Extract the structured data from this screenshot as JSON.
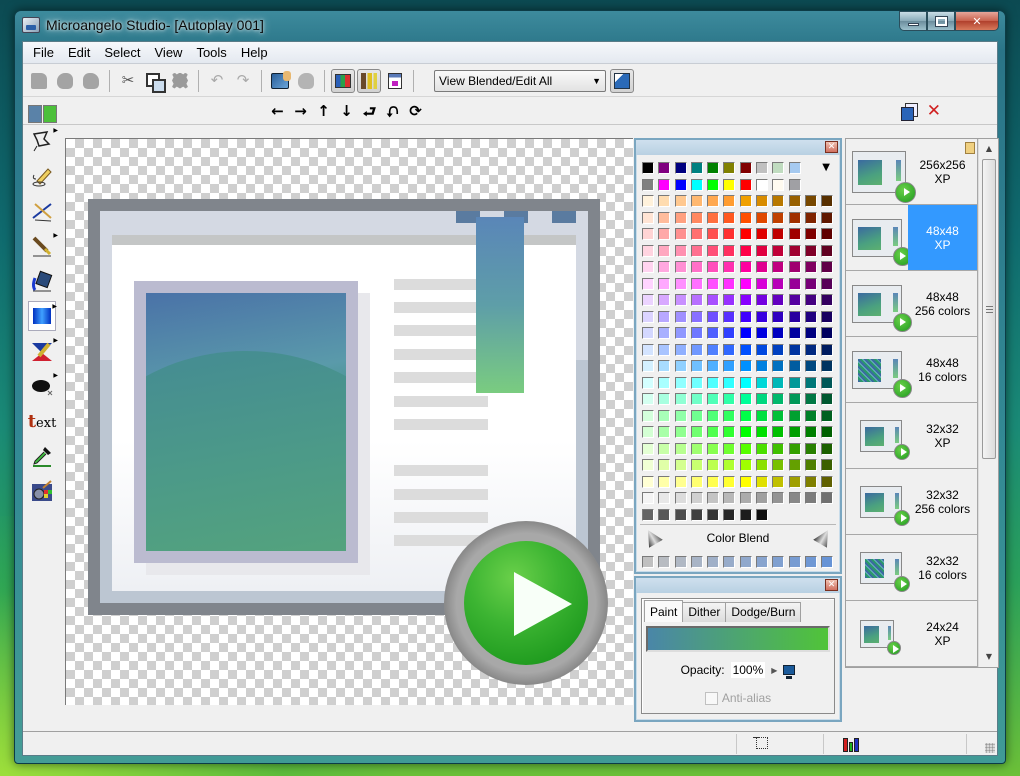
{
  "window": {
    "title": "Microangelo Studio- [Autoplay 001]",
    "caption_buttons": [
      "minimize",
      "maximize",
      "close"
    ]
  },
  "menu": [
    "File",
    "Edit",
    "Select",
    "View",
    "Tools",
    "Help"
  ],
  "toolbar": {
    "buttons": [
      {
        "name": "new-icon",
        "enabled": false
      },
      {
        "name": "open-icon",
        "enabled": false
      },
      {
        "name": "save-icon",
        "enabled": false
      },
      {
        "name": "cut-icon",
        "enabled": false
      },
      {
        "name": "copy-icon",
        "enabled": true
      },
      {
        "name": "paste-icon",
        "enabled": false
      },
      {
        "name": "undo-icon",
        "enabled": false
      },
      {
        "name": "redo-icon",
        "enabled": false
      },
      {
        "name": "import-icon",
        "enabled": true
      },
      {
        "name": "export-icon",
        "enabled": false
      },
      {
        "name": "palette-toggle-icon",
        "pressed": true
      },
      {
        "name": "tools-toggle-icon",
        "pressed": true
      },
      {
        "name": "window-icon",
        "pressed": false
      }
    ],
    "view_select": {
      "value": "View Blended/Edit All"
    },
    "preview_button": "preview-icon"
  },
  "toolbar2": {
    "primary_color": "#5a82a8",
    "secondary_color": "#4cc03a",
    "transforms": [
      "←",
      "→",
      "↑",
      "↓",
      "⮐",
      "⮏",
      "⟳"
    ],
    "transform_names": [
      "shift-left",
      "shift-right",
      "shift-up",
      "shift-down",
      "flip-horizontal",
      "flip-vertical",
      "rotate"
    ],
    "right_tools": [
      "duplicate-format-icon",
      "delete-format-icon"
    ]
  },
  "toolbox": [
    {
      "name": "lasso-select-tool",
      "submenu": true
    },
    {
      "name": "freehand-pencil-tool",
      "submenu": false
    },
    {
      "name": "line-tool",
      "submenu": false
    },
    {
      "name": "brush-tool",
      "submenu": true
    },
    {
      "name": "fill-bucket-tool",
      "submenu": false
    },
    {
      "name": "gradient-fill-tool",
      "submenu": true,
      "active": true
    },
    {
      "name": "color-replace-tool",
      "submenu": true
    },
    {
      "name": "ellipse-tool",
      "submenu": true
    },
    {
      "name": "text-tool",
      "submenu": false
    },
    {
      "name": "eyedropper-tool",
      "submenu": false
    },
    {
      "name": "effects-tool",
      "submenu": false
    }
  ],
  "palette": {
    "base_rows": [
      [
        "#000000",
        "#800080",
        "#000080",
        "#008080",
        "#008000",
        "#808000",
        "#800000",
        "#c0c0c0",
        "#c0dcc0",
        "#a6caf0"
      ],
      [
        "#808080",
        "#ff00ff",
        "#0000ff",
        "#00ffff",
        "#00ff00",
        "#ffff00",
        "#ff0000",
        "#ffffff",
        "#fffbf0",
        "#a0a0a4"
      ]
    ],
    "grid_rows": [
      [
        "#fff2dc",
        "#ffdcb0",
        "#ffc890",
        "#ffb870",
        "#ffa850",
        "#ff9c30",
        "#f0a000",
        "#d88c00",
        "#b87800",
        "#986000",
        "#784800",
        "#583000"
      ],
      [
        "#ffe4d4",
        "#ffbc9c",
        "#ffa080",
        "#ff8860",
        "#ff7040",
        "#ff5820",
        "#ff5000",
        "#e04800",
        "#c04000",
        "#a03000",
        "#802400",
        "#601800"
      ],
      [
        "#ffd4d4",
        "#ffa8a8",
        "#ff9090",
        "#ff7070",
        "#ff5050",
        "#ff3030",
        "#ff0000",
        "#e00000",
        "#c00000",
        "#a00000",
        "#800000",
        "#600000"
      ],
      [
        "#ffd4e0",
        "#ffa8c0",
        "#ff90b0",
        "#ff7090",
        "#ff5078",
        "#ff3060",
        "#ff0048",
        "#e00040",
        "#c00038",
        "#a00030",
        "#800028",
        "#600020"
      ],
      [
        "#ffd4f0",
        "#ffa8e0",
        "#ff90d4",
        "#ff70c8",
        "#ff50bc",
        "#ff30b0",
        "#ff00a0",
        "#e00090",
        "#c00080",
        "#a00070",
        "#800060",
        "#600048"
      ],
      [
        "#ffd4ff",
        "#ffa8ff",
        "#ff90ff",
        "#ff70ff",
        "#ff50ff",
        "#ff30ff",
        "#ff00ff",
        "#d800d8",
        "#b800b8",
        "#980098",
        "#780078",
        "#580058"
      ],
      [
        "#ecd4ff",
        "#d8a8ff",
        "#c890ff",
        "#b870ff",
        "#a850ff",
        "#9830ff",
        "#8800ff",
        "#7400e0",
        "#6400c0",
        "#5400a0",
        "#440080",
        "#340060"
      ],
      [
        "#dcd4ff",
        "#b8a8ff",
        "#a090ff",
        "#8870ff",
        "#7050ff",
        "#5830ff",
        "#4000ff",
        "#3800e0",
        "#3000c0",
        "#2800a0",
        "#200080",
        "#180060"
      ],
      [
        "#d4d8ff",
        "#a8b0ff",
        "#9098ff",
        "#7078ff",
        "#5060ff",
        "#3040ff",
        "#0000ff",
        "#0000e0",
        "#0000c0",
        "#0000a0",
        "#000080",
        "#000060"
      ],
      [
        "#d4e4ff",
        "#a8c4ff",
        "#90b0ff",
        "#7098ff",
        "#5080ff",
        "#3068ff",
        "#0050ff",
        "#0048e0",
        "#0040c0",
        "#0034a0",
        "#002880",
        "#001c60"
      ],
      [
        "#d4f0ff",
        "#a8dcff",
        "#90d0ff",
        "#70c0ff",
        "#50b0ff",
        "#30a0ff",
        "#0090ff",
        "#0080e0",
        "#0070c0",
        "#005ca0",
        "#004880",
        "#003460"
      ],
      [
        "#d4ffff",
        "#a8ffff",
        "#90ffff",
        "#70ffff",
        "#50ffff",
        "#30ffff",
        "#00ffff",
        "#00d8d8",
        "#00b8b8",
        "#009898",
        "#007878",
        "#005858"
      ],
      [
        "#d4fff0",
        "#a8ffe0",
        "#90ffd4",
        "#70ffc8",
        "#50ffb8",
        "#30ffa8",
        "#00ff98",
        "#00d880",
        "#00b86c",
        "#009858",
        "#007844",
        "#005830"
      ],
      [
        "#d4ffdc",
        "#a8ffb8",
        "#90ffa8",
        "#70ff90",
        "#50ff78",
        "#30ff60",
        "#00ff48",
        "#00e040",
        "#00c038",
        "#00a030",
        "#008028",
        "#006020"
      ],
      [
        "#d4ffd4",
        "#a8ffa8",
        "#90ff90",
        "#70ff70",
        "#50ff50",
        "#30ff30",
        "#00ff00",
        "#00e000",
        "#00c000",
        "#00a000",
        "#008000",
        "#006000"
      ],
      [
        "#e4ffd4",
        "#c8ffa8",
        "#b8ff90",
        "#a0ff70",
        "#88ff50",
        "#70ff30",
        "#58ff00",
        "#4ce000",
        "#40c000",
        "#34a000",
        "#288000",
        "#1c6000"
      ],
      [
        "#f0ffd4",
        "#e0ffa8",
        "#d4ff90",
        "#c8ff70",
        "#bcff50",
        "#b0ff30",
        "#a0ff00",
        "#8ce000",
        "#78c000",
        "#64a000",
        "#508000",
        "#3c6000"
      ],
      [
        "#ffffd4",
        "#ffffa8",
        "#ffff90",
        "#ffff70",
        "#ffff50",
        "#ffff30",
        "#ffff00",
        "#e0e000",
        "#c0c000",
        "#a0a000",
        "#808000",
        "#606000"
      ],
      [
        "#f4f4f4",
        "#e8e8e8",
        "#dcdcdc",
        "#d0d0d0",
        "#c4c4c4",
        "#b8b8b8",
        "#acacac",
        "#a0a0a0",
        "#949494",
        "#888888",
        "#7c7c7c",
        "#707070"
      ],
      [
        "#646464",
        "#585858",
        "#4c4c4c",
        "#404040",
        "#343434",
        "#282828",
        "#1c1c1c",
        "#101010"
      ]
    ],
    "color_blend_label": "Color Blend",
    "blend_row": [
      "#c0c0c0",
      "#b8bcc2",
      "#b0b8c4",
      "#a8b4c6",
      "#a0b0c8",
      "#98acca",
      "#90a8cc",
      "#88a4ce",
      "#80a0d0",
      "#789cd2",
      "#7098d4",
      "#6894d6"
    ]
  },
  "paint_panel": {
    "tabs": [
      "Paint",
      "Dither",
      "Dodge/Burn"
    ],
    "active_tab": "Paint",
    "gradient_from": "#4a86a8",
    "gradient_to": "#50c438",
    "opacity_label": "Opacity:",
    "opacity_value": "100%",
    "antialias_label": "Anti-alias",
    "antialias_checked": false,
    "antialias_enabled": false
  },
  "formats": [
    {
      "size": "256x256",
      "depth": "XP",
      "selected": false,
      "dither": false
    },
    {
      "size": "48x48",
      "depth": "XP",
      "selected": true,
      "dither": false
    },
    {
      "size": "48x48",
      "depth": "256 colors",
      "selected": false,
      "dither": false
    },
    {
      "size": "48x48",
      "depth": "16 colors",
      "selected": false,
      "dither": true
    },
    {
      "size": "32x32",
      "depth": "XP",
      "selected": false,
      "dither": false
    },
    {
      "size": "32x32",
      "depth": "256 colors",
      "selected": false,
      "dither": false
    },
    {
      "size": "32x32",
      "depth": "16 colors",
      "selected": false,
      "dither": true
    },
    {
      "size": "24x24",
      "depth": "XP",
      "selected": false,
      "dither": false
    }
  ],
  "statusbar": {
    "icons": [
      "selection-icon",
      "color-depth-icon"
    ]
  }
}
